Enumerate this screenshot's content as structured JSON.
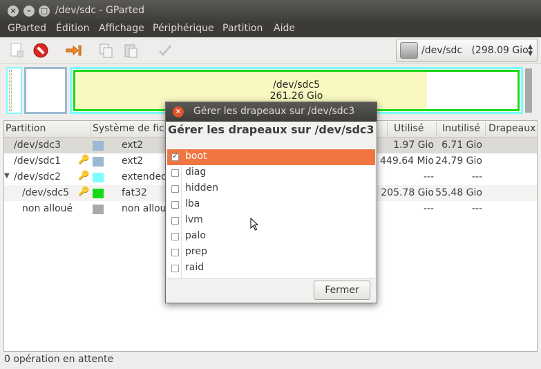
{
  "window": {
    "title": "/dev/sdc - GParted"
  },
  "menubar": {
    "items": [
      "GParted",
      "Édition",
      "Affichage",
      "Périphérique",
      "Partition",
      "Aide"
    ]
  },
  "toolbar": {
    "device_label": "/dev/sdc",
    "device_size": "(298.09 Gio)"
  },
  "partition_map": {
    "selected_name": "/dev/sdc5",
    "selected_size": "261.26 Gio",
    "colors": {
      "ext2": "#9db8d2",
      "extended": "#7dfcfe",
      "fat32": "#18d918",
      "unallocated": "#a9a9a9",
      "used": "#f8f8c0"
    }
  },
  "table": {
    "columns": {
      "partition": "Partition",
      "filesystem": "Système de fichiers",
      "used": "Utilisé",
      "unused": "Inutilisé",
      "flags": "Drapeaux"
    },
    "rows": [
      {
        "partition": "/dev/sdc3",
        "fs": "ext2",
        "used": "1.97 Gio",
        "unused": "6.71 Gio",
        "key": false
      },
      {
        "partition": "/dev/sdc1",
        "fs": "ext2",
        "used": "449.64 Mio",
        "unused": "24.79 Gio",
        "key": true
      },
      {
        "partition": "/dev/sdc2",
        "fs": "extended",
        "used": "---",
        "unused": "---",
        "key": true
      },
      {
        "partition": "/dev/sdc5",
        "fs": "fat32",
        "used": "205.78 Gio",
        "unused": "55.48 Gio",
        "key": true
      },
      {
        "partition": "non alloué",
        "fs": "non alloué",
        "used": "---",
        "unused": "---",
        "key": false
      }
    ]
  },
  "status": {
    "text": "0 opération en attente"
  },
  "dialog": {
    "title": "Gérer les drapeaux sur /dev/sdc3",
    "heading": "Gérer les drapeaux sur /dev/sdc3",
    "flags": [
      {
        "label": "boot",
        "checked": true
      },
      {
        "label": "diag",
        "checked": false
      },
      {
        "label": "hidden",
        "checked": false
      },
      {
        "label": "lba",
        "checked": false
      },
      {
        "label": "lvm",
        "checked": false
      },
      {
        "label": "palo",
        "checked": false
      },
      {
        "label": "prep",
        "checked": false
      },
      {
        "label": "raid",
        "checked": false
      }
    ],
    "close_label": "Fermer"
  }
}
